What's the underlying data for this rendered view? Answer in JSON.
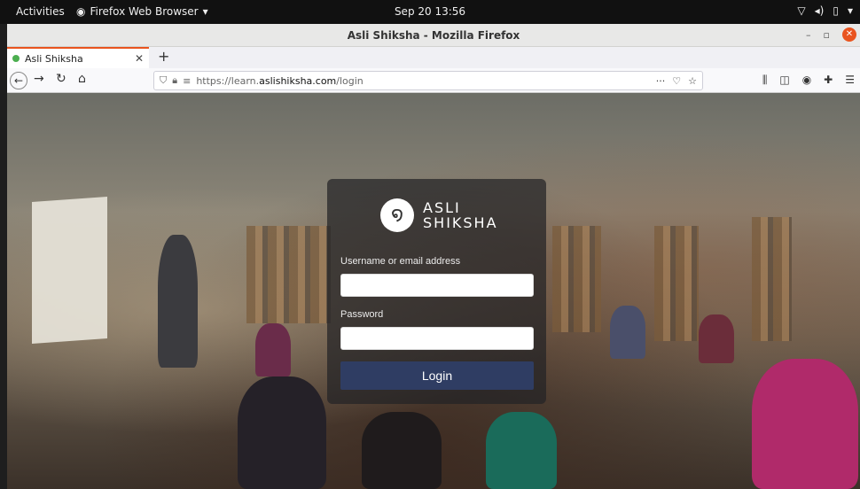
{
  "topbar": {
    "activities": "Activities",
    "app_name": "Firefox Web Browser",
    "clock": "Sep 20  13:56"
  },
  "window": {
    "title": "Asli Shiksha - Mozilla Firefox"
  },
  "tabs": [
    {
      "label": "Asli Shiksha"
    }
  ],
  "nav": {
    "url_prefix": "https://learn.",
    "url_domain": "aslishiksha.com",
    "url_path": "/login"
  },
  "login": {
    "brand_line1": "ASLI",
    "brand_line2": "SHIKSHA",
    "username_label": "Username or email address",
    "username_value": "",
    "password_label": "Password",
    "password_value": "",
    "login_button": "Login"
  },
  "colors": {
    "accent": "#e9541f",
    "login_button": "#2f3d63"
  }
}
